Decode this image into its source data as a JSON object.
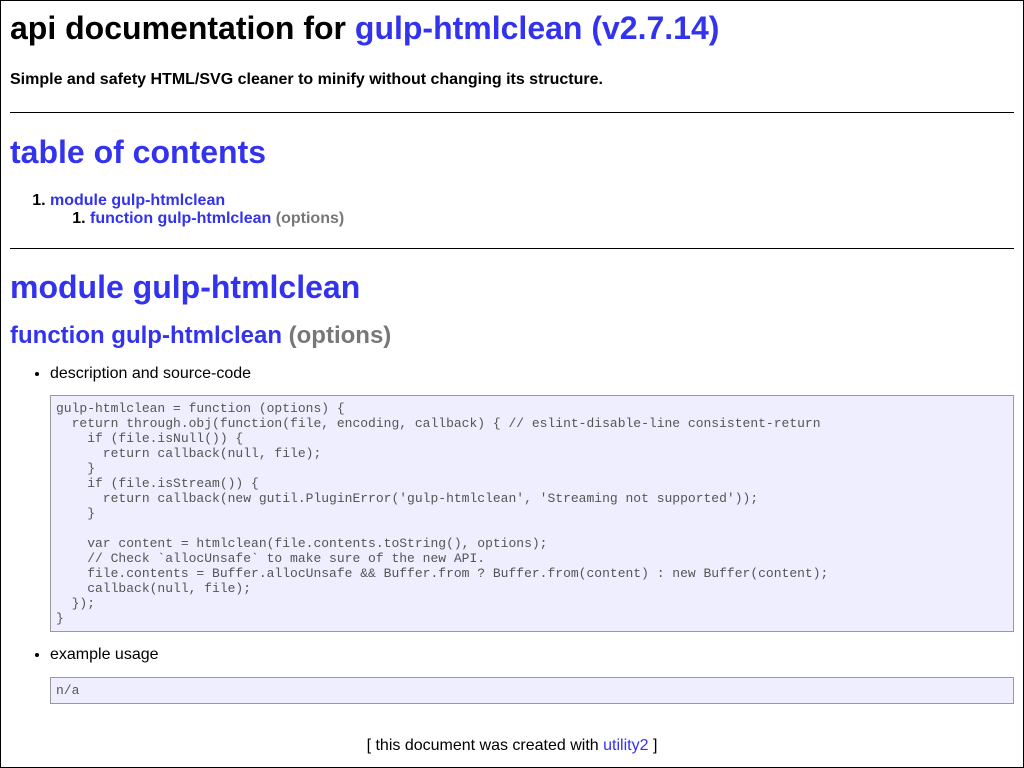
{
  "header": {
    "title_prefix": "api documentation for",
    "title_link": "gulp-htmlclean (v2.7.14)",
    "subtitle": "Simple and safety HTML/SVG cleaner to minify without changing its structure."
  },
  "toc": {
    "title": "table of contents",
    "items": [
      {
        "number": "1.",
        "label": "module gulp-htmlclean",
        "children": [
          {
            "number": "1.",
            "label": "function gulp-htmlclean",
            "signature": "(options)"
          }
        ]
      }
    ]
  },
  "module": {
    "title": "module gulp-htmlclean",
    "function": {
      "name": "function gulp-htmlclean",
      "signature": "(options)"
    }
  },
  "sections": {
    "description_label": "description and source-code",
    "source_code": "gulp-htmlclean = function (options) {\n  return through.obj(function(file, encoding, callback) { // eslint-disable-line consistent-return\n    if (file.isNull()) {\n      return callback(null, file);\n    }\n    if (file.isStream()) {\n      return callback(new gutil.PluginError('gulp-htmlclean', 'Streaming not supported'));\n    }\n\n    var content = htmlclean(file.contents.toString(), options);\n    // Check `allocUnsafe` to make sure of the new API.\n    file.contents = Buffer.allocUnsafe && Buffer.from ? Buffer.from(content) : new Buffer(content);\n    callback(null, file);\n  });\n}",
    "example_label": "example usage",
    "example_code": "n/a"
  },
  "footer": {
    "prefix": "[ this document was created with",
    "link": "utility2",
    "suffix": "]"
  }
}
